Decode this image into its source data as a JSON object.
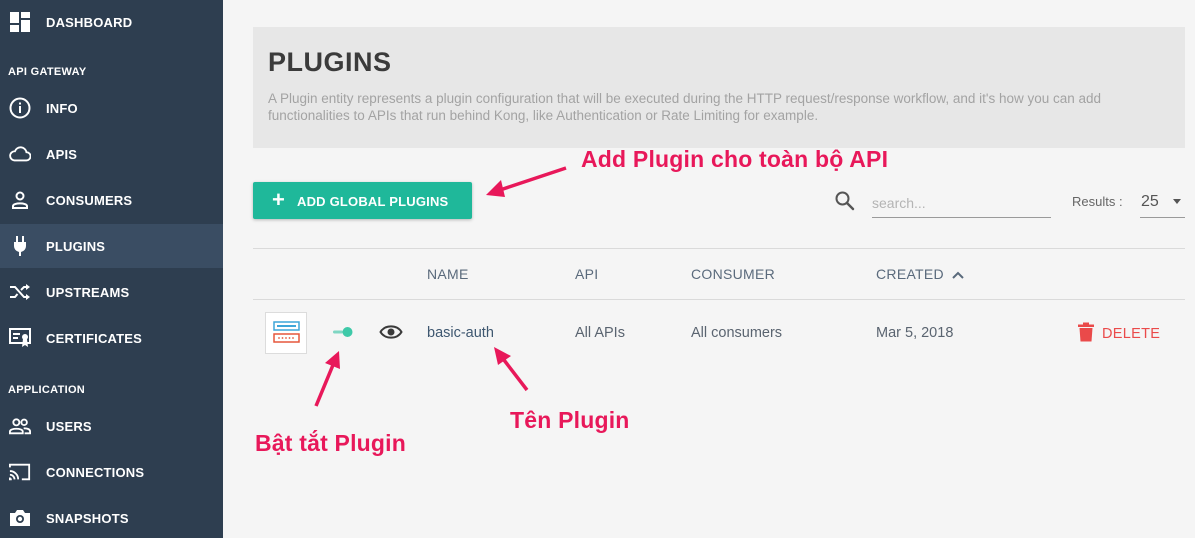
{
  "sidebar": {
    "items": [
      {
        "name": "dashboard",
        "label": "DASHBOARD",
        "icon": "dashboard-icon"
      },
      {
        "name": "info",
        "label": "INFO",
        "icon": "info-icon"
      },
      {
        "name": "apis",
        "label": "APIS",
        "icon": "cloud-icon"
      },
      {
        "name": "consumers",
        "label": "CONSUMERS",
        "icon": "user-icon"
      },
      {
        "name": "plugins",
        "label": "PLUGINS",
        "icon": "plug-icon"
      },
      {
        "name": "upstreams",
        "label": "UPSTREAMS",
        "icon": "shuffle-icon"
      },
      {
        "name": "certificates",
        "label": "CERTIFICATES",
        "icon": "certificate-icon"
      },
      {
        "name": "users",
        "label": "USERS",
        "icon": "people-icon"
      },
      {
        "name": "connections",
        "label": "CONNECTIONS",
        "icon": "cast-icon"
      },
      {
        "name": "snapshots",
        "label": "SNAPSHOTS",
        "icon": "camera-icon"
      }
    ],
    "sections": {
      "api_gateway": "API GATEWAY",
      "application": "APPLICATION"
    },
    "active": "plugins"
  },
  "header": {
    "title": "PLUGINS",
    "description": "A Plugin entity represents a plugin configuration that will be executed during the HTTP request/response workflow, and it's how you can add functionalities to APIs that run behind Kong, like Authentication or Rate Limiting for example."
  },
  "toolbar": {
    "add_button_label": "ADD GLOBAL PLUGINS",
    "add_button_icon": "plus-icon",
    "search_placeholder": "search...",
    "search_value": "",
    "results_label": "Results :",
    "results_value": "25"
  },
  "table": {
    "columns": {
      "name": "NAME",
      "api": "API",
      "consumer": "CONSUMER",
      "created": "CREATED"
    },
    "sort": {
      "column": "created",
      "direction": "ascending"
    },
    "rows": [
      {
        "name": "basic-auth",
        "api": "All APIs",
        "consumer": "All consumers",
        "created": "Mar 5, 2018",
        "enabled": true,
        "delete_label": "DELETE"
      }
    ]
  },
  "annotations": {
    "add_plugin": "Add Plugin cho toàn bộ API",
    "toggle_plugin": "Bật tắt Plugin",
    "plugin_name": "Tên Plugin"
  },
  "colors": {
    "sidebar_bg": "#2e3e50",
    "sidebar_active": "#3a4d63",
    "accent": "#1fb89a",
    "danger": "#ea4a4a",
    "annotation": "#e8185a"
  }
}
